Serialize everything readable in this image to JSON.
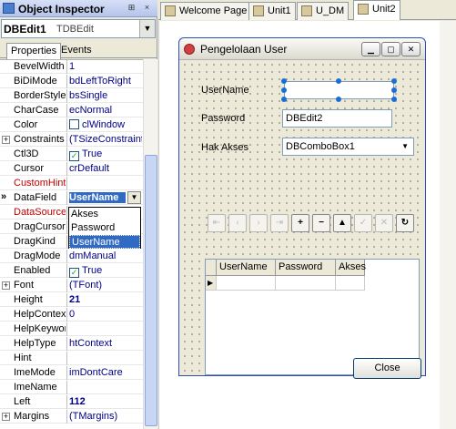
{
  "inspector": {
    "title": "Object Inspector",
    "pin_glyph": "⊞",
    "close_glyph": "×",
    "selected_name": "DBEdit1",
    "selected_class": "TDBEdit",
    "tabs": [
      "Properties",
      "Events"
    ],
    "properties": [
      {
        "k": "BevelWidth",
        "v": "1"
      },
      {
        "k": "BiDiMode",
        "v": "bdLeftToRight"
      },
      {
        "k": "BorderStyle",
        "v": "bsSingle"
      },
      {
        "k": "CharCase",
        "v": "ecNormal"
      },
      {
        "k": "Color",
        "v": "clWindow"
      },
      {
        "k": "Constraints",
        "v": "(TSizeConstraint"
      },
      {
        "k": "Ctl3D",
        "v": "True"
      },
      {
        "k": "Cursor",
        "v": "crDefault"
      },
      {
        "k": "CustomHint",
        "v": ""
      },
      {
        "k": "DataField",
        "v": "UserName"
      },
      {
        "k": "DataSource",
        "v": "Akses"
      },
      {
        "k": "DragCursor",
        "v": "Password"
      },
      {
        "k": "DragKind",
        "v": "UserName"
      },
      {
        "k": "DragMode",
        "v": "dmManual"
      },
      {
        "k": "Enabled",
        "v": "True"
      },
      {
        "k": "Font",
        "v": "(TFont)"
      },
      {
        "k": "Height",
        "v": "21"
      },
      {
        "k": "HelpContext",
        "v": "0"
      },
      {
        "k": "HelpKeyword",
        "v": ""
      },
      {
        "k": "HelpType",
        "v": "htContext"
      },
      {
        "k": "Hint",
        "v": ""
      },
      {
        "k": "ImeMode",
        "v": "imDontCare"
      },
      {
        "k": "ImeName",
        "v": ""
      },
      {
        "k": "Left",
        "v": "112"
      },
      {
        "k": "Margins",
        "v": "(TMargins)"
      }
    ],
    "datafield_options": [
      "Akses",
      "Password",
      "UserName"
    ]
  },
  "editor_tabs": [
    "Welcome Page",
    "Unit1",
    "U_DM",
    "Unit2"
  ],
  "form": {
    "title": "Pengelolaan User",
    "labels": {
      "username": "UserName",
      "password": "Password",
      "hak_akses": "Hak Akses"
    },
    "password_edit": "DBEdit2",
    "combo": "DBComboBox1",
    "grid_columns": [
      "UserName",
      "Password",
      "Akses"
    ],
    "close_label": "Close"
  },
  "colors": {
    "accent": "#316ac5",
    "form_border": "#2a4eb8"
  }
}
